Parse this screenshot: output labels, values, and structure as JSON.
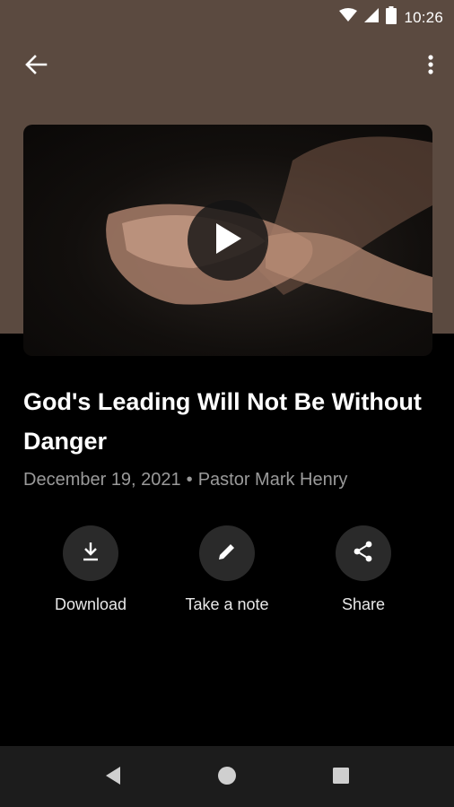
{
  "status_bar": {
    "time": "10:26",
    "icons": [
      "wifi-icon",
      "signal-icon",
      "battery-icon"
    ]
  },
  "app_bar": {
    "back_icon": "arrow-back-icon",
    "more_icon": "more-vert-icon"
  },
  "video": {
    "play_icon": "play-icon"
  },
  "sermon": {
    "title": "God's Leading Will Not Be Without Danger",
    "date": "December 19, 2021",
    "separator": "•",
    "speaker": "Pastor Mark Henry"
  },
  "actions": [
    {
      "label": "Download",
      "icon": "download-icon"
    },
    {
      "label": "Take a note",
      "icon": "pencil-icon"
    },
    {
      "label": "Share",
      "icon": "share-icon"
    }
  ],
  "nav_bar": {
    "icons": [
      "nav-back-icon",
      "nav-home-icon",
      "nav-recents-icon"
    ]
  },
  "colors": {
    "hero_bg": "#5b4a40",
    "background": "#000000",
    "action_circle": "#2a2a2a",
    "meta_text": "#9a9a9a",
    "nav_bar": "#1c1c1c"
  }
}
